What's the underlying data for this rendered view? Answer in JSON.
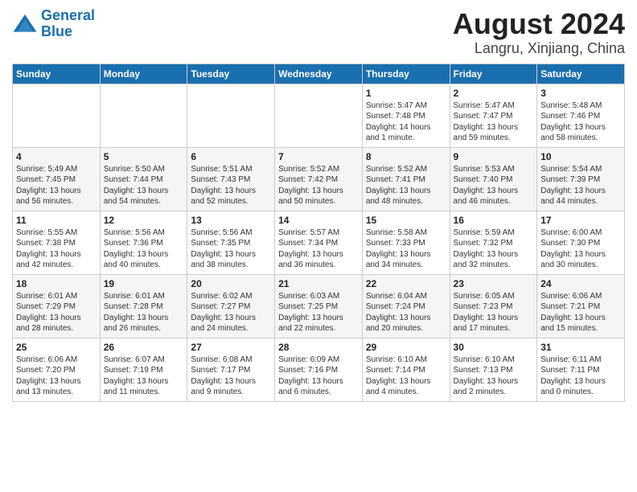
{
  "logo": {
    "text_general": "General",
    "text_blue": "Blue"
  },
  "title": "August 2024",
  "subtitle": "Langru, Xinjiang, China",
  "weekdays": [
    "Sunday",
    "Monday",
    "Tuesday",
    "Wednesday",
    "Thursday",
    "Friday",
    "Saturday"
  ],
  "weeks": [
    [
      {
        "day": "",
        "info": ""
      },
      {
        "day": "",
        "info": ""
      },
      {
        "day": "",
        "info": ""
      },
      {
        "day": "",
        "info": ""
      },
      {
        "day": "1",
        "info": "Sunrise: 5:47 AM\nSunset: 7:48 PM\nDaylight: 14 hours\nand 1 minute."
      },
      {
        "day": "2",
        "info": "Sunrise: 5:47 AM\nSunset: 7:47 PM\nDaylight: 13 hours\nand 59 minutes."
      },
      {
        "day": "3",
        "info": "Sunrise: 5:48 AM\nSunset: 7:46 PM\nDaylight: 13 hours\nand 58 minutes."
      }
    ],
    [
      {
        "day": "4",
        "info": "Sunrise: 5:49 AM\nSunset: 7:45 PM\nDaylight: 13 hours\nand 56 minutes."
      },
      {
        "day": "5",
        "info": "Sunrise: 5:50 AM\nSunset: 7:44 PM\nDaylight: 13 hours\nand 54 minutes."
      },
      {
        "day": "6",
        "info": "Sunrise: 5:51 AM\nSunset: 7:43 PM\nDaylight: 13 hours\nand 52 minutes."
      },
      {
        "day": "7",
        "info": "Sunrise: 5:52 AM\nSunset: 7:42 PM\nDaylight: 13 hours\nand 50 minutes."
      },
      {
        "day": "8",
        "info": "Sunrise: 5:52 AM\nSunset: 7:41 PM\nDaylight: 13 hours\nand 48 minutes."
      },
      {
        "day": "9",
        "info": "Sunrise: 5:53 AM\nSunset: 7:40 PM\nDaylight: 13 hours\nand 46 minutes."
      },
      {
        "day": "10",
        "info": "Sunrise: 5:54 AM\nSunset: 7:39 PM\nDaylight: 13 hours\nand 44 minutes."
      }
    ],
    [
      {
        "day": "11",
        "info": "Sunrise: 5:55 AM\nSunset: 7:38 PM\nDaylight: 13 hours\nand 42 minutes."
      },
      {
        "day": "12",
        "info": "Sunrise: 5:56 AM\nSunset: 7:36 PM\nDaylight: 13 hours\nand 40 minutes."
      },
      {
        "day": "13",
        "info": "Sunrise: 5:56 AM\nSunset: 7:35 PM\nDaylight: 13 hours\nand 38 minutes."
      },
      {
        "day": "14",
        "info": "Sunrise: 5:57 AM\nSunset: 7:34 PM\nDaylight: 13 hours\nand 36 minutes."
      },
      {
        "day": "15",
        "info": "Sunrise: 5:58 AM\nSunset: 7:33 PM\nDaylight: 13 hours\nand 34 minutes."
      },
      {
        "day": "16",
        "info": "Sunrise: 5:59 AM\nSunset: 7:32 PM\nDaylight: 13 hours\nand 32 minutes."
      },
      {
        "day": "17",
        "info": "Sunrise: 6:00 AM\nSunset: 7:30 PM\nDaylight: 13 hours\nand 30 minutes."
      }
    ],
    [
      {
        "day": "18",
        "info": "Sunrise: 6:01 AM\nSunset: 7:29 PM\nDaylight: 13 hours\nand 28 minutes."
      },
      {
        "day": "19",
        "info": "Sunrise: 6:01 AM\nSunset: 7:28 PM\nDaylight: 13 hours\nand 26 minutes."
      },
      {
        "day": "20",
        "info": "Sunrise: 6:02 AM\nSunset: 7:27 PM\nDaylight: 13 hours\nand 24 minutes."
      },
      {
        "day": "21",
        "info": "Sunrise: 6:03 AM\nSunset: 7:25 PM\nDaylight: 13 hours\nand 22 minutes."
      },
      {
        "day": "22",
        "info": "Sunrise: 6:04 AM\nSunset: 7:24 PM\nDaylight: 13 hours\nand 20 minutes."
      },
      {
        "day": "23",
        "info": "Sunrise: 6:05 AM\nSunset: 7:23 PM\nDaylight: 13 hours\nand 17 minutes."
      },
      {
        "day": "24",
        "info": "Sunrise: 6:06 AM\nSunset: 7:21 PM\nDaylight: 13 hours\nand 15 minutes."
      }
    ],
    [
      {
        "day": "25",
        "info": "Sunrise: 6:06 AM\nSunset: 7:20 PM\nDaylight: 13 hours\nand 13 minutes."
      },
      {
        "day": "26",
        "info": "Sunrise: 6:07 AM\nSunset: 7:19 PM\nDaylight: 13 hours\nand 11 minutes."
      },
      {
        "day": "27",
        "info": "Sunrise: 6:08 AM\nSunset: 7:17 PM\nDaylight: 13 hours\nand 9 minutes."
      },
      {
        "day": "28",
        "info": "Sunrise: 6:09 AM\nSunset: 7:16 PM\nDaylight: 13 hours\nand 6 minutes."
      },
      {
        "day": "29",
        "info": "Sunrise: 6:10 AM\nSunset: 7:14 PM\nDaylight: 13 hours\nand 4 minutes."
      },
      {
        "day": "30",
        "info": "Sunrise: 6:10 AM\nSunset: 7:13 PM\nDaylight: 13 hours\nand 2 minutes."
      },
      {
        "day": "31",
        "info": "Sunrise: 6:11 AM\nSunset: 7:11 PM\nDaylight: 13 hours\nand 0 minutes."
      }
    ]
  ]
}
